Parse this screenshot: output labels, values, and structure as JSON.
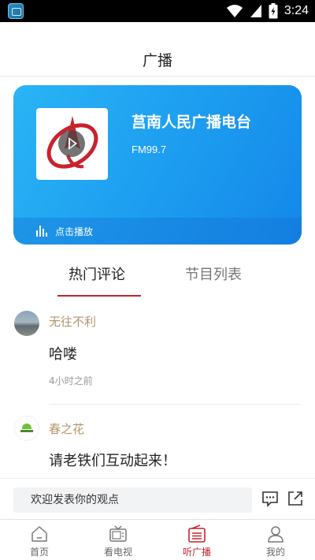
{
  "status_bar": {
    "time": "3:24"
  },
  "header": {
    "title": "广播"
  },
  "station": {
    "name": "莒南人民广播电台",
    "frequency": "FM99.7",
    "play_label": "点击播放"
  },
  "tabs": [
    {
      "label": "热门评论",
      "active": true
    },
    {
      "label": "节目列表",
      "active": false
    }
  ],
  "comments": [
    {
      "user": "无往不利",
      "text": "哈喽",
      "time": "4小时之前"
    },
    {
      "user": "春之花",
      "text": "请老铁们互动起来！"
    }
  ],
  "comment_bar": {
    "placeholder": "欢迎发表你的观点"
  },
  "bottom_nav": [
    {
      "label": "首页",
      "icon": "home-icon"
    },
    {
      "label": "看电视",
      "icon": "tv-icon"
    },
    {
      "label": "听广播",
      "icon": "radio-icon",
      "active": true
    },
    {
      "label": "我的",
      "icon": "user-icon"
    }
  ],
  "colors": {
    "accent": "#c8232d",
    "card_blue": "#1c9cf0",
    "username": "#b29466"
  }
}
